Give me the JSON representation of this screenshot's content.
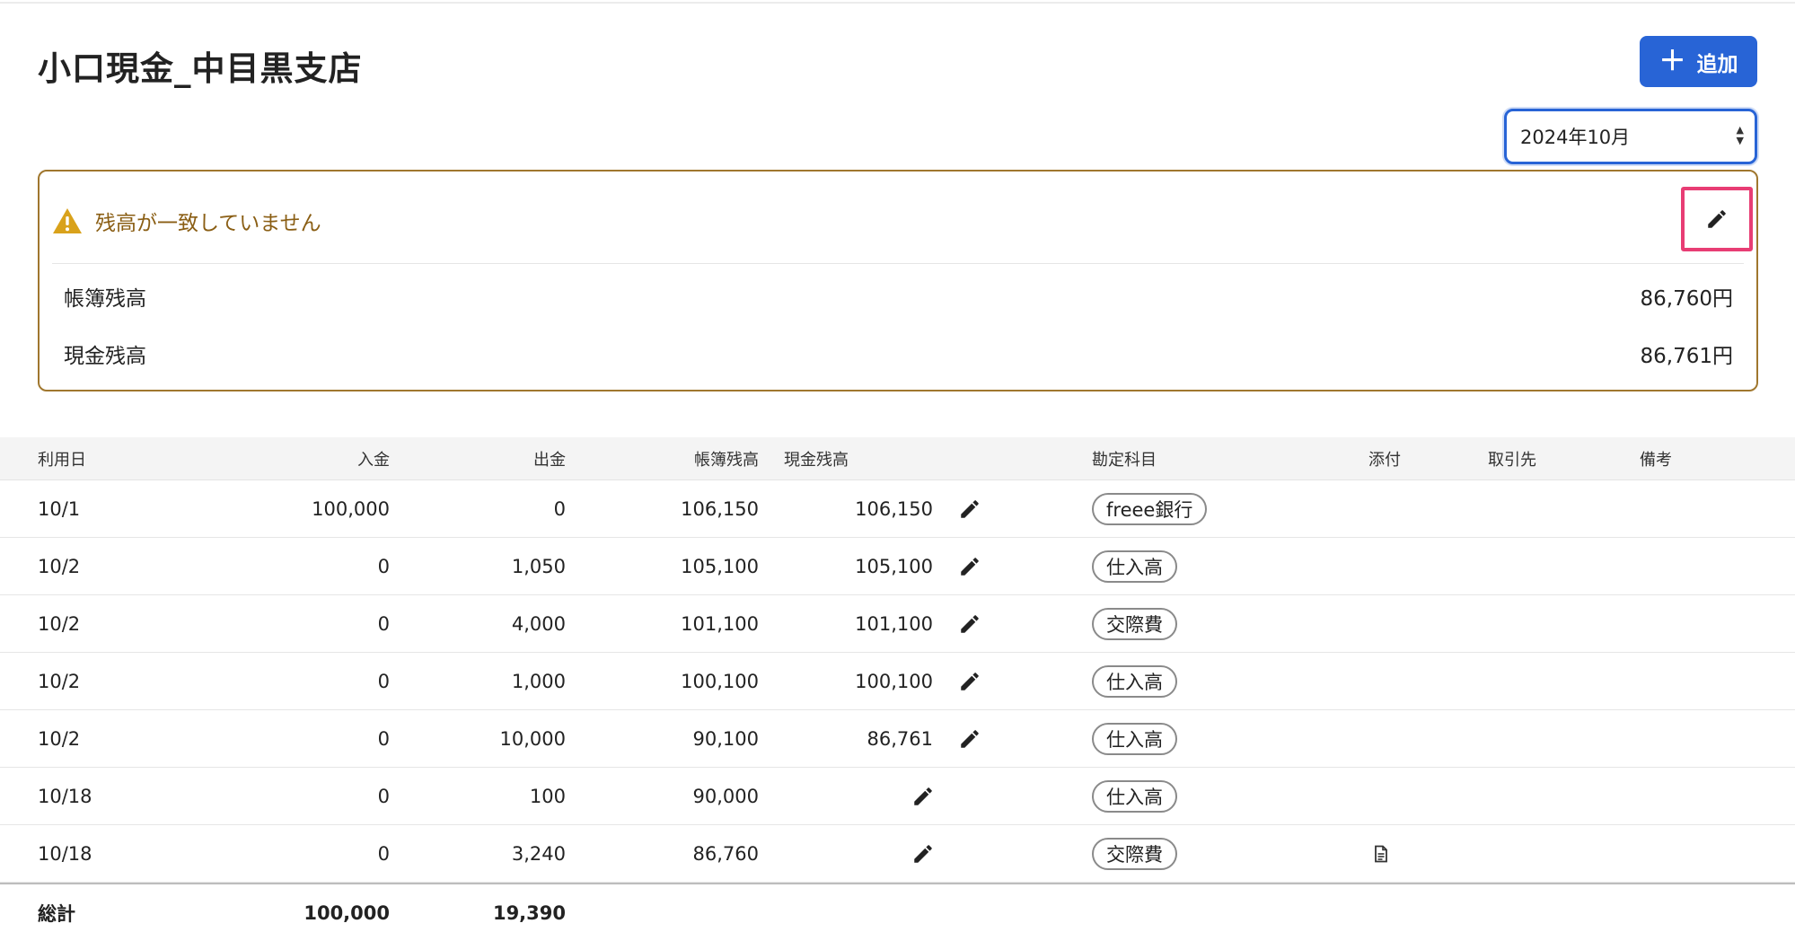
{
  "page": {
    "title": "小口現金_中目黒支店",
    "add_button": {
      "icon": "plus-icon",
      "label": "追加"
    },
    "month_select": {
      "value": "2024年10月"
    }
  },
  "alert": {
    "icon": "warning-triangle-icon",
    "message": "残高が一致していません",
    "edit_icon": "pencil-icon",
    "book_balance": {
      "label": "帳簿残高",
      "value": "86,760円"
    },
    "cash_balance": {
      "label": "現金残高",
      "value": "86,761円"
    }
  },
  "table": {
    "headers": {
      "date": "利用日",
      "deposit": "入金",
      "withdrawal": "出金",
      "book_balance": "帳簿残高",
      "cash_balance": "現金残高",
      "account": "勘定科目",
      "attachment": "添付",
      "partner": "取引先",
      "memo": "備考"
    },
    "rows": [
      {
        "date": "10/1",
        "deposit": "100,000",
        "withdrawal": "0",
        "book_balance": "106,150",
        "cash_balance": "106,150",
        "account": "freee銀行",
        "attachment": false
      },
      {
        "date": "10/2",
        "deposit": "0",
        "withdrawal": "1,050",
        "book_balance": "105,100",
        "cash_balance": "105,100",
        "account": "仕入高",
        "attachment": false
      },
      {
        "date": "10/2",
        "deposit": "0",
        "withdrawal": "4,000",
        "book_balance": "101,100",
        "cash_balance": "101,100",
        "account": "交際費",
        "attachment": false
      },
      {
        "date": "10/2",
        "deposit": "0",
        "withdrawal": "1,000",
        "book_balance": "100,100",
        "cash_balance": "100,100",
        "account": "仕入高",
        "attachment": false
      },
      {
        "date": "10/2",
        "deposit": "0",
        "withdrawal": "10,000",
        "book_balance": "90,100",
        "cash_balance": "86,761",
        "account": "仕入高",
        "attachment": false
      },
      {
        "date": "10/18",
        "deposit": "0",
        "withdrawal": "100",
        "book_balance": "90,000",
        "cash_balance": "",
        "account": "仕入高",
        "attachment": false
      },
      {
        "date": "10/18",
        "deposit": "0",
        "withdrawal": "3,240",
        "book_balance": "86,760",
        "cash_balance": "",
        "account": "交際費",
        "attachment": true
      }
    ],
    "totals": {
      "label": "総計",
      "deposit": "100,000",
      "withdrawal": "19,390"
    }
  },
  "colors": {
    "primary": "#2864d6",
    "warning_text": "#8a5e14",
    "warning_border": "#a0772e",
    "warning_icon": "#d9a21b",
    "highlight_border": "#e83d74"
  }
}
